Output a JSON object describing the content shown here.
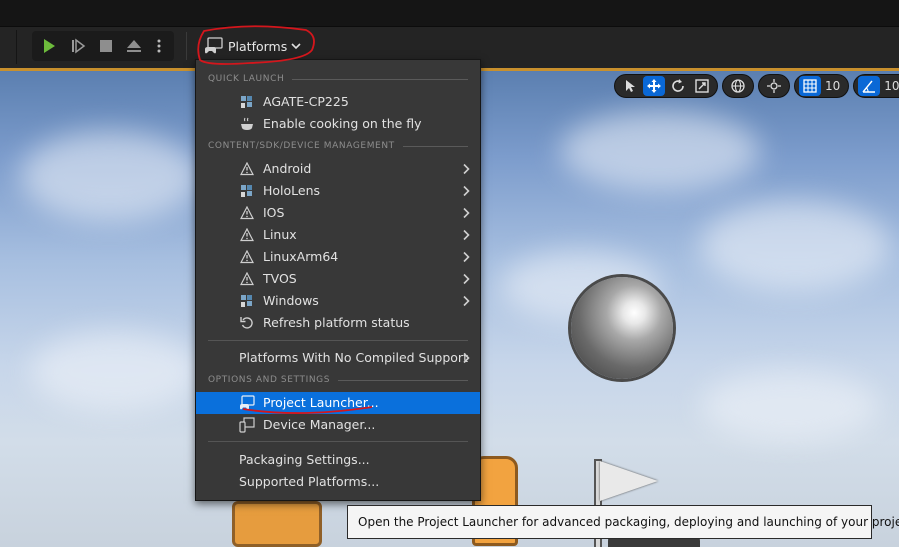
{
  "toolbar": {
    "play_icon": "play-icon",
    "advance_frame_icon": "advance-frame-icon",
    "stop_icon": "stop-icon",
    "eject_icon": "eject-icon",
    "more_icon": "vertical-dots-icon",
    "platforms_label": "Platforms",
    "platforms_icon": "gamepad-monitor-icon",
    "play_color": "#6dbb3c"
  },
  "viewport_controls": {
    "grid_snap_value": "10",
    "angle_snap_value": "10°",
    "active_color": "#0a68d6"
  },
  "menu": {
    "section_quick_launch": "QUICK LAUNCH",
    "section_sdk": "CONTENT/SDK/DEVICE MANAGEMENT",
    "section_options": "OPTIONS AND SETTINGS",
    "items": {
      "agate": "AGATE-CP225",
      "cooking": "Enable cooking on the fly",
      "android": "Android",
      "hololens": "HoloLens",
      "ios": "IOS",
      "linux": "Linux",
      "linuxarm": "LinuxArm64",
      "tvos": "TVOS",
      "windows": "Windows",
      "refresh": "Refresh platform status",
      "no_compiled": "Platforms With No Compiled Support",
      "project_launcher": "Project Launcher...",
      "device_manager": "Device Manager...",
      "packaging": "Packaging Settings...",
      "supported": "Supported Platforms..."
    },
    "highlight_color": "#0a70dc"
  },
  "tooltip": {
    "text": "Open the Project Launcher for advanced packaging, deploying and launching of your projects"
  },
  "annotation_color": "#d4161c"
}
